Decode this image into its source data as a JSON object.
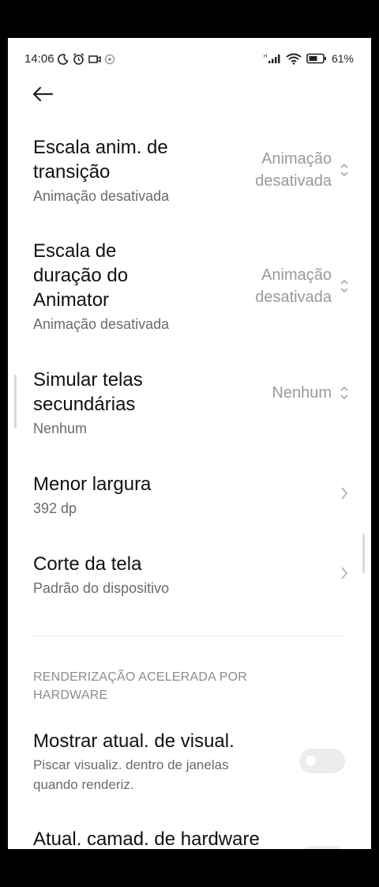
{
  "status_bar": {
    "time": "14:06",
    "battery_percent": "61",
    "icons": [
      "moon-icon",
      "alarm-icon",
      "screen-record-icon",
      "hotspot-icon",
      "signal-icon",
      "wifi-icon",
      "battery-icon"
    ]
  },
  "header": {
    "back_icon": "arrow-left-icon"
  },
  "items": [
    {
      "title_lines": [
        "Escala anim. de",
        "transição"
      ],
      "subtitle": "Animação desativada",
      "value_lines": [
        "Animação",
        "desativada"
      ],
      "control": "chevron-up-down-icon"
    },
    {
      "title_lines": [
        "Escala de",
        "duração do",
        "Animator"
      ],
      "subtitle": "Animação desativada",
      "value_lines": [
        "Animação",
        "desativada"
      ],
      "control": "chevron-up-down-icon"
    },
    {
      "title_lines": [
        "Simular telas",
        "secundárias"
      ],
      "subtitle": "Nenhum",
      "value_lines": [
        "Nenhum"
      ],
      "control": "chevron-up-down-icon"
    },
    {
      "title_lines": [
        "Menor largura"
      ],
      "subtitle": "392 dp",
      "control": "chevron-right-icon"
    },
    {
      "title_lines": [
        "Corte da tela"
      ],
      "subtitle": "Padrão do dispositivo",
      "control": "chevron-right-icon"
    }
  ],
  "section": {
    "header_lines": [
      "RENDERIZAÇÃO ACELERADA POR",
      "HARDWARE"
    ]
  },
  "toggles": [
    {
      "title": "Mostrar atual. de visual.",
      "subtitle_lines": [
        "Piscar visualiz. dentro de janelas",
        "quando renderiz."
      ],
      "on": false
    },
    {
      "title": "Atual. camad. de hardware",
      "on": false
    }
  ],
  "colors": {
    "background": "#ffffff",
    "text": "#111111",
    "secondary": "#6b6b6b",
    "value": "#9a9a9a",
    "toggle_off": "#ececec"
  }
}
